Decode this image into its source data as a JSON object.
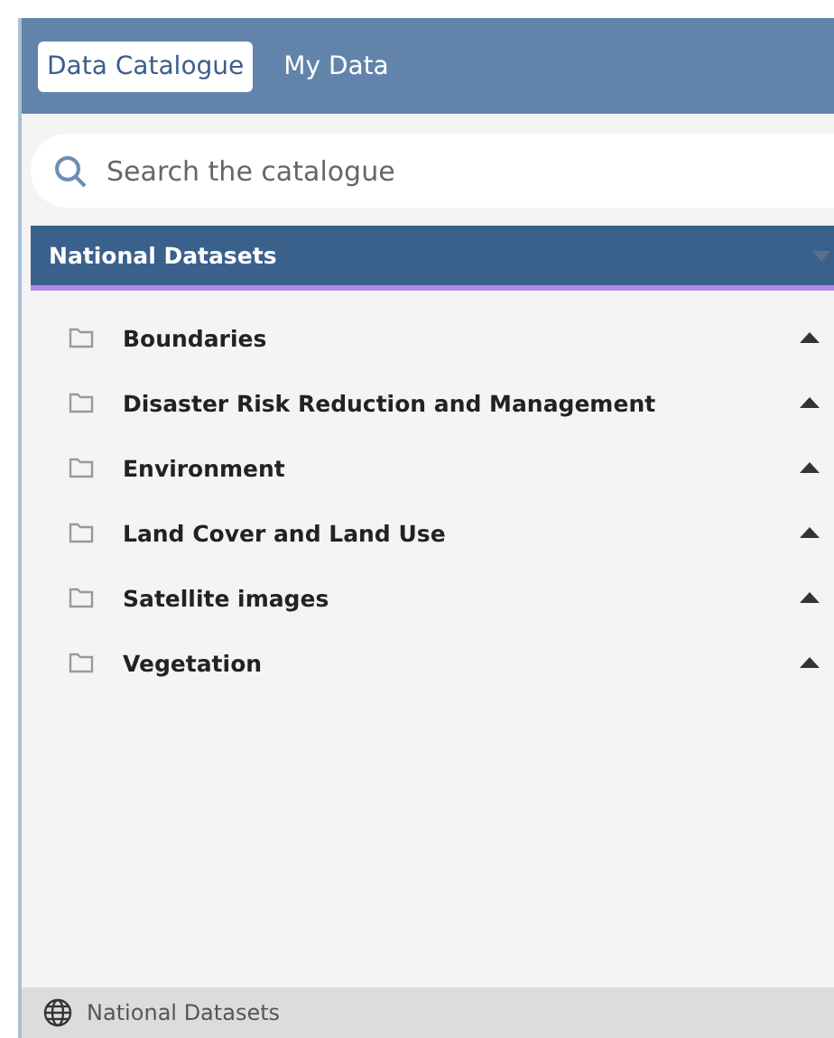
{
  "tabs": [
    {
      "label": "Data Catalogue",
      "selected": true
    },
    {
      "label": "My Data",
      "selected": false
    }
  ],
  "search": {
    "placeholder": "Search the catalogue"
  },
  "section": {
    "title": "National Datasets",
    "expanded": true
  },
  "items": [
    {
      "label": "Boundaries",
      "expanded": false
    },
    {
      "label": "Disaster Risk Reduction and Management",
      "expanded": false
    },
    {
      "label": "Environment",
      "expanded": false
    },
    {
      "label": "Land Cover and Land Use",
      "expanded": false
    },
    {
      "label": "Satellite images",
      "expanded": false
    },
    {
      "label": "Vegetation",
      "expanded": false
    }
  ],
  "status_bar": {
    "label": "National Datasets"
  }
}
